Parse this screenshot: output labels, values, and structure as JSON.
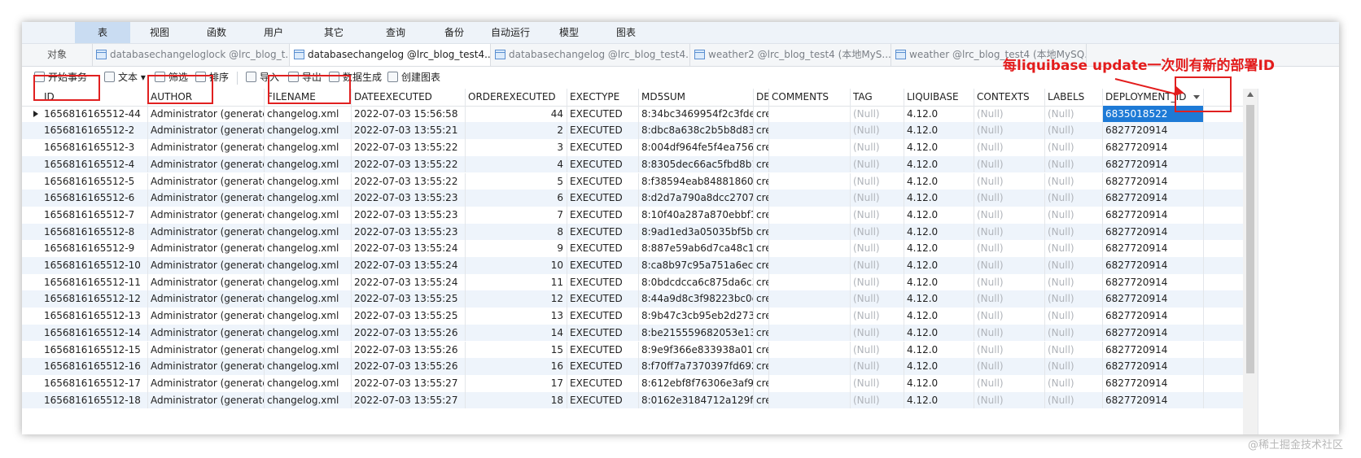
{
  "menu": [
    "表",
    "视图",
    "函数",
    "用户",
    "其它",
    "查询",
    "备份",
    "自动运行",
    "模型",
    "图表"
  ],
  "tabs": {
    "objects": "对象",
    "items": [
      "databasechangeloglock @lrc_blog_t...",
      "databasechangelog @lrc_blog_test4...",
      "databasechangelog @lrc_blog_test4...",
      "weather2 @lrc_blog_test4 (本地MyS...",
      "weather @lrc_blog_test4 (本地MySQ..."
    ]
  },
  "toolbar": {
    "begin_tx": "开始事务",
    "text": "文本",
    "filter": "筛选",
    "sort": "排序",
    "import": "导入",
    "export": "导出",
    "data_gen": "数据生成",
    "create_chart": "创建图表"
  },
  "columns": [
    "ID",
    "AUTHOR",
    "FILENAME",
    "DATEEXECUTED",
    "ORDEREXECUTED",
    "EXECTYPE",
    "MD5SUM",
    "DES",
    "COMMENTS",
    "TAG",
    "LIQUIBASE",
    "CONTEXTS",
    "LABELS",
    "DEPLOYMENT_ID"
  ],
  "rows": [
    [
      "1656816165512-44",
      "Administrator (generated)",
      "changelog.xml",
      "2022-07-03 15:56:58",
      "44",
      "EXECUTED",
      "8:34bc3469954f2c3fde592",
      "cre",
      "",
      "(Null)",
      "4.12.0",
      "(Null)",
      "(Null)",
      "6835018522"
    ],
    [
      "1656816165512-2",
      "Administrator (generated)",
      "changelog.xml",
      "2022-07-03 13:55:21",
      "2",
      "EXECUTED",
      "8:dbc8a638c2b5b8d83f37",
      "cre",
      "",
      "(Null)",
      "4.12.0",
      "(Null)",
      "(Null)",
      "6827720914"
    ],
    [
      "1656816165512-3",
      "Administrator (generated)",
      "changelog.xml",
      "2022-07-03 13:55:22",
      "3",
      "EXECUTED",
      "8:004df964fe5f4ea756566",
      "cre",
      "",
      "(Null)",
      "4.12.0",
      "(Null)",
      "(Null)",
      "6827720914"
    ],
    [
      "1656816165512-4",
      "Administrator (generated)",
      "changelog.xml",
      "2022-07-03 13:55:22",
      "4",
      "EXECUTED",
      "8:8305dec66ac5fbd8b142",
      "cre",
      "",
      "(Null)",
      "4.12.0",
      "(Null)",
      "(Null)",
      "6827720914"
    ],
    [
      "1656816165512-5",
      "Administrator (generated)",
      "changelog.xml",
      "2022-07-03 13:55:22",
      "5",
      "EXECUTED",
      "8:f38594eab84881860b89",
      "cre",
      "",
      "(Null)",
      "4.12.0",
      "(Null)",
      "(Null)",
      "6827720914"
    ],
    [
      "1656816165512-6",
      "Administrator (generated)",
      "changelog.xml",
      "2022-07-03 13:55:23",
      "6",
      "EXECUTED",
      "8:d2d7a790a8dcc2707452",
      "cre",
      "",
      "(Null)",
      "4.12.0",
      "(Null)",
      "(Null)",
      "6827720914"
    ],
    [
      "1656816165512-7",
      "Administrator (generated)",
      "changelog.xml",
      "2022-07-03 13:55:23",
      "7",
      "EXECUTED",
      "8:10f40a287a870ebbf174",
      "cre",
      "",
      "(Null)",
      "4.12.0",
      "(Null)",
      "(Null)",
      "6827720914"
    ],
    [
      "1656816165512-8",
      "Administrator (generated)",
      "changelog.xml",
      "2022-07-03 13:55:23",
      "8",
      "EXECUTED",
      "8:9ad1ed3a05035bf5bcdf",
      "cre",
      "",
      "(Null)",
      "4.12.0",
      "(Null)",
      "(Null)",
      "6827720914"
    ],
    [
      "1656816165512-9",
      "Administrator (generated)",
      "changelog.xml",
      "2022-07-03 13:55:24",
      "9",
      "EXECUTED",
      "8:887e59ab6d7ca48c1665",
      "cre",
      "",
      "(Null)",
      "4.12.0",
      "(Null)",
      "(Null)",
      "6827720914"
    ],
    [
      "1656816165512-10",
      "Administrator (generated)",
      "changelog.xml",
      "2022-07-03 13:55:24",
      "10",
      "EXECUTED",
      "8:ca8b97c95a751a6eca38",
      "cre",
      "",
      "(Null)",
      "4.12.0",
      "(Null)",
      "(Null)",
      "6827720914"
    ],
    [
      "1656816165512-11",
      "Administrator (generated)",
      "changelog.xml",
      "2022-07-03 13:55:24",
      "11",
      "EXECUTED",
      "8:0bdcdcca6c875da6c3f3",
      "cre",
      "",
      "(Null)",
      "4.12.0",
      "(Null)",
      "(Null)",
      "6827720914"
    ],
    [
      "1656816165512-12",
      "Administrator (generated)",
      "changelog.xml",
      "2022-07-03 13:55:25",
      "12",
      "EXECUTED",
      "8:44a9d8c3f98223bc0ee2",
      "cre",
      "",
      "(Null)",
      "4.12.0",
      "(Null)",
      "(Null)",
      "6827720914"
    ],
    [
      "1656816165512-13",
      "Administrator (generated)",
      "changelog.xml",
      "2022-07-03 13:55:25",
      "13",
      "EXECUTED",
      "8:9b47c3cb95eb2d273d7",
      "cre",
      "",
      "(Null)",
      "4.12.0",
      "(Null)",
      "(Null)",
      "6827720914"
    ],
    [
      "1656816165512-14",
      "Administrator (generated)",
      "changelog.xml",
      "2022-07-03 13:55:26",
      "14",
      "EXECUTED",
      "8:be215559682053e13eb",
      "cre",
      "",
      "(Null)",
      "4.12.0",
      "(Null)",
      "(Null)",
      "6827720914"
    ],
    [
      "1656816165512-15",
      "Administrator (generated)",
      "changelog.xml",
      "2022-07-03 13:55:26",
      "15",
      "EXECUTED",
      "8:9e9f366e833938a01bf6",
      "cre",
      "",
      "(Null)",
      "4.12.0",
      "(Null)",
      "(Null)",
      "6827720914"
    ],
    [
      "1656816165512-16",
      "Administrator (generated)",
      "changelog.xml",
      "2022-07-03 13:55:26",
      "16",
      "EXECUTED",
      "8:f70ff7a7370397fd6920",
      "cre",
      "",
      "(Null)",
      "4.12.0",
      "(Null)",
      "(Null)",
      "6827720914"
    ],
    [
      "1656816165512-17",
      "Administrator (generated)",
      "changelog.xml",
      "2022-07-03 13:55:27",
      "17",
      "EXECUTED",
      "8:612ebf8f76306e3af9af7",
      "cre",
      "",
      "(Null)",
      "4.12.0",
      "(Null)",
      "(Null)",
      "6827720914"
    ],
    [
      "1656816165512-18",
      "Administrator (generated)",
      "changelog.xml",
      "2022-07-03 13:55:27",
      "18",
      "EXECUTED",
      "8:0162e3184712a129fa8a",
      "cre",
      "",
      "(Null)",
      "4.12.0",
      "(Null)",
      "(Null)",
      "6827720914"
    ]
  ],
  "callout": "每liquibase update一次则有新的部署ID",
  "watermark": "@稀土掘金技术社区",
  "colors": {
    "annotation_red": "#e31c1c",
    "selection_blue": "#1e7ad6",
    "alt_row": "#eef4fb"
  }
}
